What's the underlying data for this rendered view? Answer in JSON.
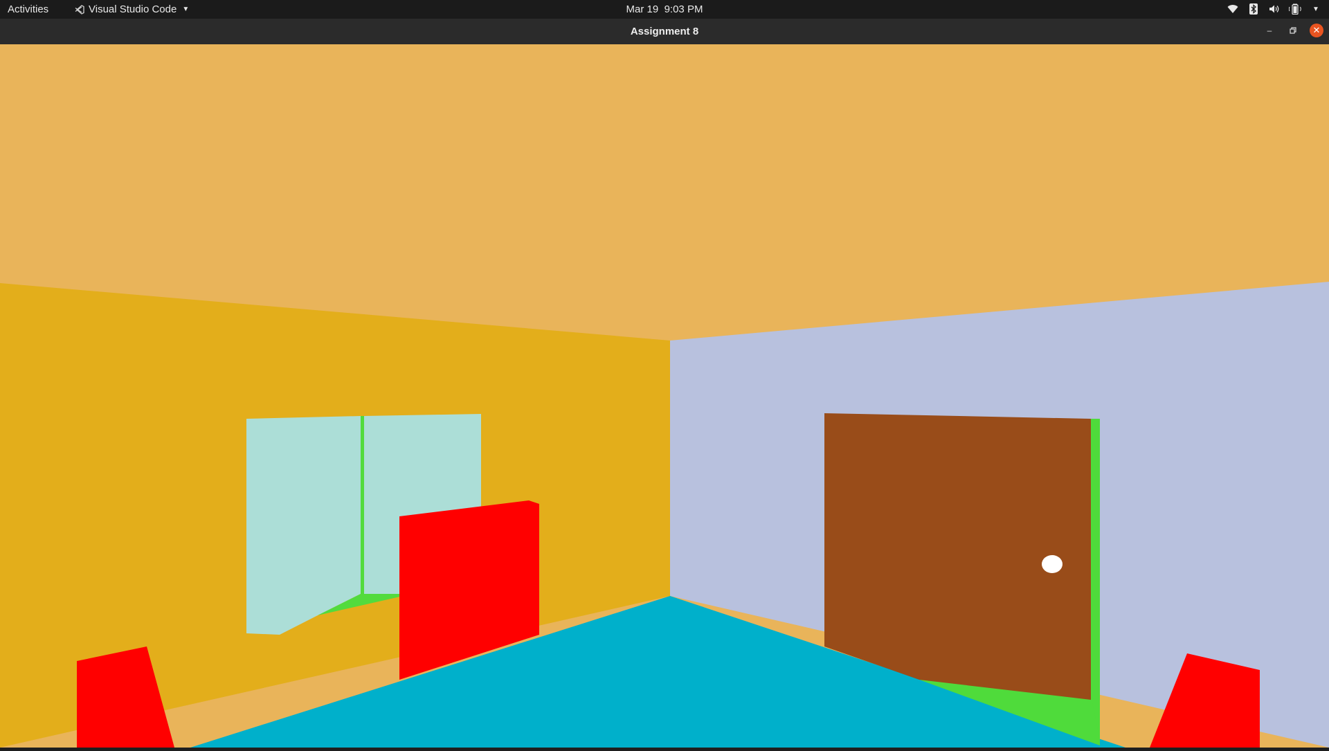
{
  "topbar": {
    "activities_label": "Activities",
    "app_menu_label": "Visual Studio Code",
    "clock_date": "Mar 19",
    "clock_time": "9:03 PM"
  },
  "window": {
    "title": "Assignment 8"
  },
  "icons": {
    "app": "vscode-icon",
    "wifi": "wifi-icon",
    "bluetooth": "bluetooth-icon",
    "volume": "volume-icon",
    "battery": "battery-icon",
    "tray_menu": "chevron-down-icon",
    "minimize": "minimize-icon",
    "restore": "restore-icon",
    "close": "close-icon"
  },
  "colors": {
    "ceiling": "#E9B45A",
    "left_wall": "#E3AE1B",
    "right_wall": "#B8C1DE",
    "floor": "#00B0CB",
    "window_glass": "#ACDED7",
    "window_frame": "#52DB3D",
    "cube": "#FF0000",
    "door": "#994C19",
    "door_frame": "#4FDB3B",
    "door_knob": "#FFFFFF",
    "close_button": "#E95420"
  }
}
